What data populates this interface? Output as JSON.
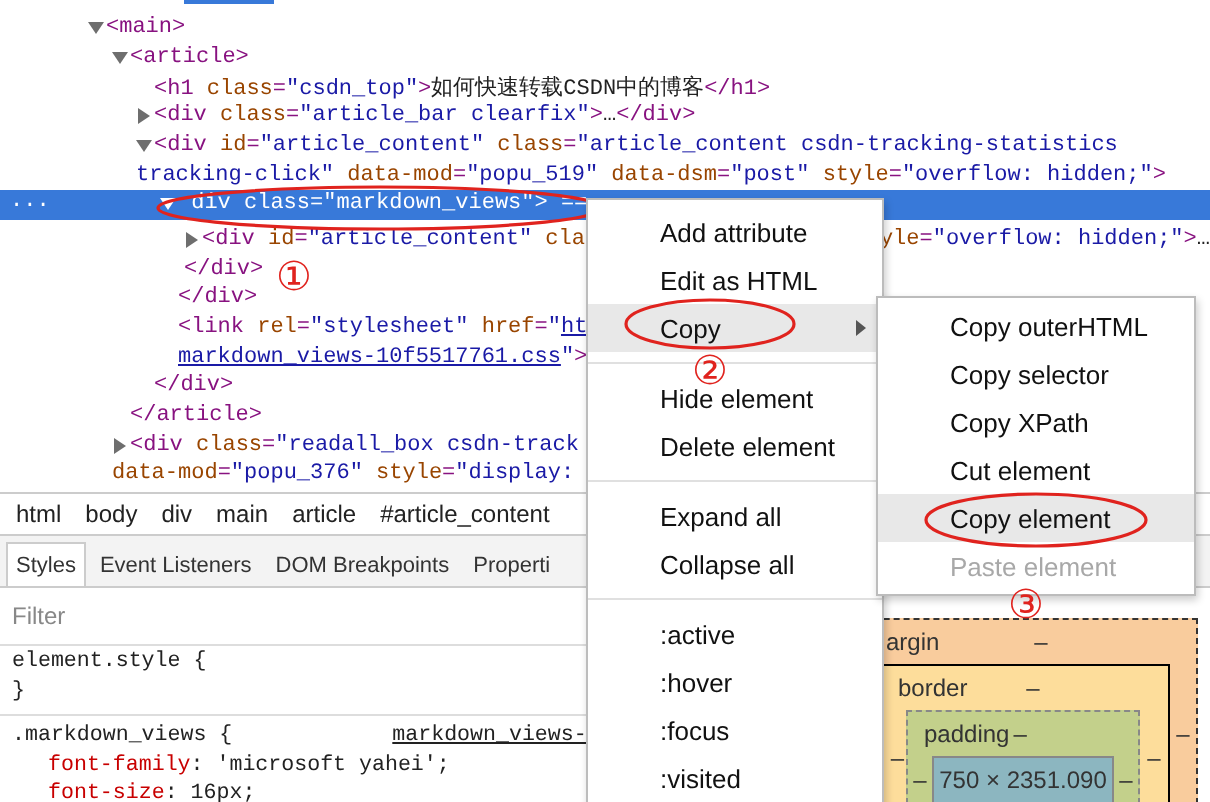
{
  "dom": {
    "row_marker": "...",
    "nodes": [
      {
        "kind": "node",
        "expanded": true,
        "selected": false,
        "lines": [
          {
            "code": [
              {
                "kind": "tag",
                "text": "<main>"
              }
            ]
          }
        ],
        "children": [
          {
            "kind": "node",
            "expanded": true,
            "selected": false,
            "lines": [
              {
                "code": [
                  {
                    "kind": "tag",
                    "text": "<article>"
                  }
                ]
              }
            ],
            "close": [
              {
                "kind": "tag",
                "text": "</article>"
              }
            ],
            "children": [
              {
                "kind": "leaf",
                "selected": false,
                "lines": [
                  {
                    "code": [
                      {
                        "kind": "tag",
                        "text": "<h1 "
                      },
                      {
                        "kind": "attr",
                        "text": "class"
                      },
                      {
                        "kind": "tag",
                        "text": "="
                      },
                      {
                        "kind": "value",
                        "text": "\"csdn_top\""
                      },
                      {
                        "kind": "tag",
                        "text": ">"
                      },
                      {
                        "kind": "text",
                        "text": "如何快速转载CSDN中的博客"
                      },
                      {
                        "kind": "tag",
                        "text": "</h1>"
                      }
                    ]
                  }
                ]
              },
              {
                "kind": "node",
                "expanded": false,
                "selected": false,
                "lines": [
                  {
                    "code": [
                      {
                        "kind": "tag",
                        "text": "<div "
                      },
                      {
                        "kind": "attr",
                        "text": "class"
                      },
                      {
                        "kind": "tag",
                        "text": "="
                      },
                      {
                        "kind": "value",
                        "text": "\"article_bar clearfix\""
                      },
                      {
                        "kind": "tag",
                        "text": ">"
                      },
                      {
                        "kind": "text",
                        "text": "…"
                      },
                      {
                        "kind": "tag",
                        "text": "</div>"
                      }
                    ]
                  }
                ]
              },
              {
                "kind": "node",
                "expanded": true,
                "selected": false,
                "lines": [
                  {
                    "code": [
                      {
                        "kind": "tag",
                        "text": "<div "
                      },
                      {
                        "kind": "attr",
                        "text": "id"
                      },
                      {
                        "kind": "tag",
                        "text": "="
                      },
                      {
                        "kind": "value",
                        "text": "\"article_content\""
                      },
                      {
                        "kind": "attr",
                        "text": " class"
                      },
                      {
                        "kind": "tag",
                        "text": "="
                      },
                      {
                        "kind": "value",
                        "text": "\"article_content csdn-tracking-statistics"
                      }
                    ]
                  },
                  {
                    "code": [
                      {
                        "kind": "value",
                        "text": "tracking-click\""
                      },
                      {
                        "kind": "attr",
                        "text": " data-mod"
                      },
                      {
                        "kind": "tag",
                        "text": "="
                      },
                      {
                        "kind": "value",
                        "text": "\"popu_519\""
                      },
                      {
                        "kind": "attr",
                        "text": " data-dsm"
                      },
                      {
                        "kind": "tag",
                        "text": "="
                      },
                      {
                        "kind": "value",
                        "text": "\"post\""
                      },
                      {
                        "kind": "attr",
                        "text": " style"
                      },
                      {
                        "kind": "tag",
                        "text": "="
                      },
                      {
                        "kind": "value",
                        "text": "\"overflow: hidden;\""
                      },
                      {
                        "kind": "tag",
                        "text": ">"
                      }
                    ]
                  }
                ],
                "close": [
                  {
                    "kind": "tag",
                    "text": "</div>"
                  }
                ],
                "children": [
                  {
                    "kind": "node",
                    "expanded": true,
                    "selected": true,
                    "lines": [
                      {
                        "code": [
                          {
                            "kind": "tag",
                            "text": "div "
                          },
                          {
                            "kind": "attr",
                            "text": "class"
                          },
                          {
                            "kind": "tag",
                            "text": "="
                          },
                          {
                            "kind": "value",
                            "text": "\"markdown_views\""
                          },
                          {
                            "kind": "tag",
                            "text": ">"
                          },
                          {
                            "kind": "text",
                            "text": " =="
                          }
                        ]
                      }
                    ],
                    "close": [
                      {
                        "kind": "tag",
                        "text": "</div>"
                      }
                    ],
                    "children": [
                      {
                        "kind": "node",
                        "expanded": false,
                        "selected": false,
                        "lines": [
                          {
                            "code": [
                              {
                                "kind": "tag",
                                "text": "<div "
                              },
                              {
                                "kind": "attr",
                                "text": "id"
                              },
                              {
                                "kind": "tag",
                                "text": "="
                              },
                              {
                                "kind": "value",
                                "text": "\"article_content\""
                              },
                              {
                                "kind": "attr",
                                "text": " cla"
                              }
                            ],
                            "tail": [
                              {
                                "kind": "attr",
                                "text": "yle"
                              },
                              {
                                "kind": "tag",
                                "text": "="
                              },
                              {
                                "kind": "value",
                                "text": "\"overflow: hidden;\""
                              },
                              {
                                "kind": "tag",
                                "text": ">"
                              },
                              {
                                "kind": "text",
                                "text": "…"
                              }
                            ]
                          },
                          {
                            "code": [
                              {
                                "kind": "tag",
                                "text": "</div>"
                              }
                            ]
                          }
                        ]
                      }
                    ]
                  },
                  {
                    "kind": "leaf",
                    "selected": false,
                    "lines": [
                      {
                        "code": [
                          {
                            "kind": "tag",
                            "text": "<link "
                          },
                          {
                            "kind": "attr",
                            "text": "rel"
                          },
                          {
                            "kind": "tag",
                            "text": "="
                          },
                          {
                            "kind": "value",
                            "text": "\"stylesheet\""
                          },
                          {
                            "kind": "attr",
                            "text": " href"
                          },
                          {
                            "kind": "tag",
                            "text": "="
                          },
                          {
                            "kind": "value",
                            "text": "\""
                          },
                          {
                            "kind": "link",
                            "text": "ht"
                          }
                        ]
                      },
                      {
                        "code": [
                          {
                            "kind": "link",
                            "text": "markdown_views-10f5517761.css"
                          },
                          {
                            "kind": "value",
                            "text": "\""
                          },
                          {
                            "kind": "tag",
                            "text": ">"
                          }
                        ]
                      }
                    ]
                  }
                ]
              }
            ]
          },
          {
            "kind": "node",
            "expanded": false,
            "selected": false,
            "lines": [
              {
                "code": [
                  {
                    "kind": "tag",
                    "text": "<div "
                  },
                  {
                    "kind": "attr",
                    "text": "class"
                  },
                  {
                    "kind": "tag",
                    "text": "="
                  },
                  {
                    "kind": "value",
                    "text": "\"readall_box csdn-track"
                  }
                ]
              },
              {
                "code": [
                  {
                    "kind": "attr",
                    "text": "data-mod"
                  },
                  {
                    "kind": "tag",
                    "text": "="
                  },
                  {
                    "kind": "value",
                    "text": "\"popu_376\""
                  },
                  {
                    "kind": "attr",
                    "text": " style"
                  },
                  {
                    "kind": "tag",
                    "text": "="
                  },
                  {
                    "kind": "value",
                    "text": "\"display:"
                  }
                ]
              }
            ]
          }
        ]
      }
    ]
  },
  "breadcrumbs": [
    "html",
    "body",
    "div",
    "main",
    "article",
    "#article_content"
  ],
  "tabs": [
    {
      "label": "Styles",
      "selected": true
    },
    {
      "label": "Event Listeners",
      "selected": false
    },
    {
      "label": "DOM Breakpoints",
      "selected": false
    },
    {
      "label": "Properti",
      "selected": false
    }
  ],
  "filter": {
    "placeholder": "Filter"
  },
  "rules": [
    {
      "selector": "element.style {",
      "close": "}"
    },
    {
      "selector": ".markdown_views {",
      "source": "markdown_views-",
      "props": [
        {
          "name": "font-family",
          "value": ": 'microsoft yahei';"
        },
        {
          "name": "font-size",
          "value": ": 16px;"
        }
      ]
    }
  ],
  "box_model": {
    "margin": {
      "label": "argin",
      "top": "–",
      "right": "–"
    },
    "border": {
      "label": "border",
      "top": "–",
      "left": "–",
      "right": "–"
    },
    "padding": {
      "label": "padding",
      "top": "–",
      "left": "–",
      "right": "–"
    },
    "content": "750 × 2351.090"
  },
  "context_menu": {
    "sections": [
      {
        "items": [
          {
            "label": "Add attribute",
            "highlighted": false,
            "submenu": false
          },
          {
            "label": "Edit as HTML",
            "highlighted": false,
            "submenu": false
          },
          {
            "label": "Copy",
            "highlighted": true,
            "submenu": true
          }
        ]
      },
      {
        "items": [
          {
            "label": "Hide element",
            "highlighted": false,
            "submenu": false
          },
          {
            "label": "Delete element",
            "highlighted": false,
            "submenu": false
          }
        ]
      },
      {
        "items": [
          {
            "label": "Expand all",
            "highlighted": false,
            "submenu": false
          },
          {
            "label": "Collapse all",
            "highlighted": false,
            "submenu": false
          }
        ]
      },
      {
        "items": [
          {
            "label": ":active",
            "highlighted": false,
            "submenu": false
          },
          {
            "label": ":hover",
            "highlighted": false,
            "submenu": false
          },
          {
            "label": ":focus",
            "highlighted": false,
            "submenu": false
          },
          {
            "label": ":visited",
            "highlighted": false,
            "submenu": false
          }
        ]
      }
    ]
  },
  "submenu": {
    "items": [
      {
        "label": "Copy outerHTML",
        "highlighted": false,
        "disabled": false
      },
      {
        "label": "Copy selector",
        "highlighted": false,
        "disabled": false
      },
      {
        "label": "Copy XPath",
        "highlighted": false,
        "disabled": false
      },
      {
        "label": "Cut element",
        "highlighted": false,
        "disabled": false
      },
      {
        "label": "Copy element",
        "highlighted": true,
        "disabled": false
      },
      {
        "label": "Paste element",
        "highlighted": false,
        "disabled": true
      }
    ]
  },
  "annotations": [
    {
      "mark": "①"
    },
    {
      "mark": "②"
    },
    {
      "mark": "③"
    }
  ]
}
